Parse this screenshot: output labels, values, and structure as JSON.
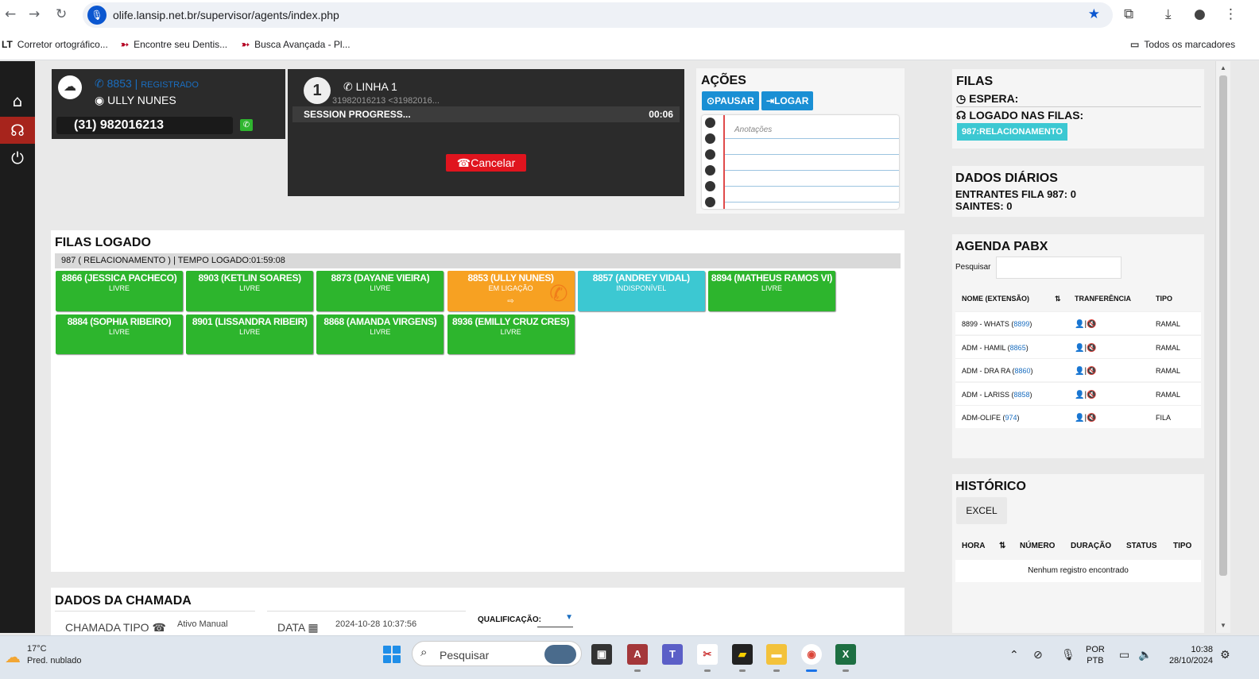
{
  "browser": {
    "url": "olife.lansip.net.br/supervisor/agents/index.php",
    "bookmarks": [
      "Corretor ortográfico...",
      "Encontre seu Dentis...",
      "Busca Avançada - Pl..."
    ],
    "bookmarks_folder": "Todos os marcadores"
  },
  "agent": {
    "extension": "8853",
    "registered": "REGISTRADO",
    "name": "ULLY NUNES",
    "phone": "(31) 982016213"
  },
  "line": {
    "number": "1",
    "name": "LINHA 1",
    "caller": "31982016213 <31982016...",
    "status": "SESSION PROGRESS...",
    "time": "00:06",
    "cancel": "Cancelar"
  },
  "acoes": {
    "title": "AÇÕES",
    "pause": "PAUSAR",
    "login": "LOGAR",
    "notes_placeholder": "Anotações"
  },
  "filas_logado": {
    "title": "FILAS LOGADO",
    "queue_bar": "987 ( RELACIONAMENTO ) | TEMPO LOGADO:01:59:08",
    "agents": [
      {
        "name": "8866 (JESSICA PACHECO)",
        "status": "LIVRE",
        "color": "#2db52d"
      },
      {
        "name": "8903 (KETLIN SOARES)",
        "status": "LIVRE",
        "color": "#2db52d"
      },
      {
        "name": "8873 (DAYANE VIEIRA)",
        "status": "LIVRE",
        "color": "#2db52d"
      },
      {
        "name": "8853 (ULLY NUNES)",
        "status": "EM LIGAÇÃO",
        "color": "#f7a122"
      },
      {
        "name": "8857 (ANDREY VIDAL)",
        "status": "INDISPONÍVEL",
        "color": "#3cc8d2"
      },
      {
        "name": "8894 (MATHEUS RAMOS VI)",
        "status": "LIVRE",
        "color": "#2db52d"
      },
      {
        "name": "8884 (SOPHIA RIBEIRO)",
        "status": "LIVRE",
        "color": "#2db52d"
      },
      {
        "name": "8901 (LISSANDRA RIBEIR)",
        "status": "LIVRE",
        "color": "#2db52d"
      },
      {
        "name": "8868 (AMANDA VIRGENS)",
        "status": "LIVRE",
        "color": "#2db52d"
      },
      {
        "name": "8936 (EMILLY CRUZ CRES)",
        "status": "LIVRE",
        "color": "#2db52d"
      }
    ]
  },
  "dados_chamada": {
    "title": "DADOS DA CHAMADA",
    "tipo_label": "CHAMADA TIPO",
    "tipo_value": "Ativo Manual",
    "data_label": "DATA",
    "data_value": "2024-10-28 10:37:56",
    "qualificacao_label": "QUALIFICAÇÃO:"
  },
  "filas": {
    "title": "FILAS",
    "espera": "ESPERA:",
    "logado": "LOGADO NAS FILAS:",
    "queue_tag": "987:RELACIONAMENTO"
  },
  "dados_diarios": {
    "title": "DADOS DIÁRIOS",
    "entrantes": "ENTRANTES FILA 987: 0",
    "saintes": "SAINTES: 0"
  },
  "agenda": {
    "title": "AGENDA PABX",
    "search_label": "Pesquisar",
    "columns": [
      "NOME (EXTENSÃO)",
      "TRANFERÊNCIA",
      "TIPO"
    ],
    "rows": [
      {
        "name": "8899 - WHATS",
        "ext": "8899",
        "tipo": "RAMAL"
      },
      {
        "name": "ADM - HAMIL",
        "ext": "8865",
        "tipo": "RAMAL"
      },
      {
        "name": "ADM - DRA RA",
        "ext": "8860",
        "tipo": "RAMAL"
      },
      {
        "name": "ADM - LARISS",
        "ext": "8858",
        "tipo": "RAMAL"
      },
      {
        "name": "ADM-OLIFE",
        "ext": "974",
        "tipo": "FILA"
      }
    ]
  },
  "historico": {
    "title": "HISTÓRICO",
    "excel": "EXCEL",
    "columns": [
      "HORA",
      "NÚMERO",
      "DURAÇÃO",
      "STATUS",
      "TIPO"
    ],
    "empty": "Nenhum registro encontrado"
  },
  "taskbar": {
    "temp": "17°C",
    "weather": "Pred. nublado",
    "search": "Pesquisar",
    "lang1": "POR",
    "lang2": "PTB",
    "time": "10:38",
    "date": "28/10/2024"
  }
}
